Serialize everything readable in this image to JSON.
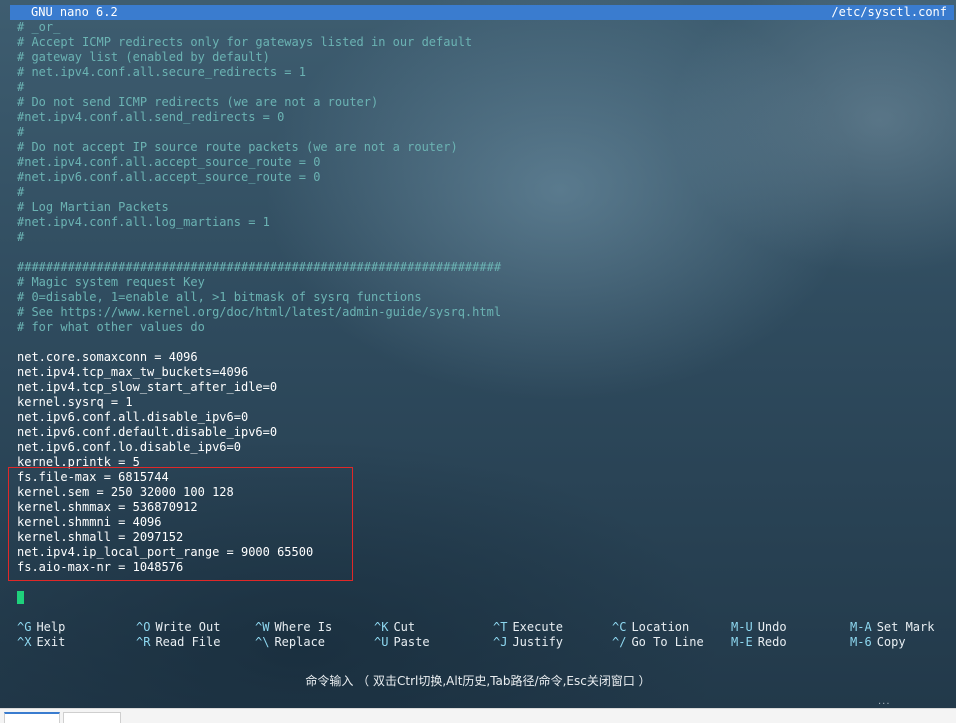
{
  "titlebar": {
    "app": "GNU nano 6.2",
    "file": "/etc/sysctl.conf"
  },
  "editor_lines": [
    {
      "type": "comment",
      "text": "# _or_"
    },
    {
      "type": "comment",
      "text": "# Accept ICMP redirects only for gateways listed in our default"
    },
    {
      "type": "comment",
      "text": "# gateway list (enabled by default)"
    },
    {
      "type": "comment",
      "text": "# net.ipv4.conf.all.secure_redirects = 1"
    },
    {
      "type": "comment",
      "text": "#"
    },
    {
      "type": "comment",
      "text": "# Do not send ICMP redirects (we are not a router)"
    },
    {
      "type": "comment",
      "text": "#net.ipv4.conf.all.send_redirects = 0"
    },
    {
      "type": "comment",
      "text": "#"
    },
    {
      "type": "comment",
      "text": "# Do not accept IP source route packets (we are not a router)"
    },
    {
      "type": "comment",
      "text": "#net.ipv4.conf.all.accept_source_route = 0"
    },
    {
      "type": "comment",
      "text": "#net.ipv6.conf.all.accept_source_route = 0"
    },
    {
      "type": "comment",
      "text": "#"
    },
    {
      "type": "comment",
      "text": "# Log Martian Packets"
    },
    {
      "type": "comment",
      "text": "#net.ipv4.conf.all.log_martians = 1"
    },
    {
      "type": "comment",
      "text": "#"
    },
    {
      "type": "blank",
      "text": ""
    },
    {
      "type": "comment",
      "text": "###################################################################"
    },
    {
      "type": "comment",
      "text": "# Magic system request Key"
    },
    {
      "type": "comment",
      "text": "# 0=disable, 1=enable all, >1 bitmask of sysrq functions"
    },
    {
      "type": "comment",
      "text": "# See https://www.kernel.org/doc/html/latest/admin-guide/sysrq.html"
    },
    {
      "type": "comment",
      "text": "# for what other values do"
    },
    {
      "type": "blank",
      "text": ""
    },
    {
      "type": "setting",
      "text": "net.core.somaxconn = 4096"
    },
    {
      "type": "setting",
      "text": "net.ipv4.tcp_max_tw_buckets=4096"
    },
    {
      "type": "setting",
      "text": "net.ipv4.tcp_slow_start_after_idle=0"
    },
    {
      "type": "setting",
      "text": "kernel.sysrq = 1"
    },
    {
      "type": "setting",
      "text": "net.ipv6.conf.all.disable_ipv6=0"
    },
    {
      "type": "setting",
      "text": "net.ipv6.conf.default.disable_ipv6=0"
    },
    {
      "type": "setting",
      "text": "net.ipv6.conf.lo.disable_ipv6=0"
    },
    {
      "type": "setting",
      "text": "kernel.printk = 5"
    },
    {
      "type": "setting",
      "text": "fs.file-max = 6815744"
    },
    {
      "type": "setting",
      "text": "kernel.sem = 250 32000 100 128"
    },
    {
      "type": "setting",
      "text": "kernel.shmmax = 536870912"
    },
    {
      "type": "setting",
      "text": "kernel.shmmni = 4096"
    },
    {
      "type": "setting",
      "text": "kernel.shmall = 2097152"
    },
    {
      "type": "setting",
      "text": "net.ipv4.ip_local_port_range = 9000 65500"
    },
    {
      "type": "setting",
      "text": "fs.aio-max-nr = 1048576"
    }
  ],
  "shortcuts": [
    {
      "key": "^G",
      "label": "Help"
    },
    {
      "key": "^O",
      "label": "Write Out"
    },
    {
      "key": "^W",
      "label": "Where Is"
    },
    {
      "key": "^K",
      "label": "Cut"
    },
    {
      "key": "^T",
      "label": "Execute"
    },
    {
      "key": "^C",
      "label": "Location"
    },
    {
      "key": "M-U",
      "label": "Undo"
    },
    {
      "key": "M-A",
      "label": "Set Mark"
    },
    {
      "key": "^X",
      "label": "Exit"
    },
    {
      "key": "^R",
      "label": "Read File"
    },
    {
      "key": "^\\",
      "label": "Replace"
    },
    {
      "key": "^U",
      "label": "Paste"
    },
    {
      "key": "^J",
      "label": "Justify"
    },
    {
      "key": "^/",
      "label": "Go To Line"
    },
    {
      "key": "M-E",
      "label": "Redo"
    },
    {
      "key": "M-6",
      "label": "Copy"
    }
  ],
  "command_bar": {
    "text": "命令输入 （ 双击Ctrl切换,Alt历史,Tab路径/命令,Esc关闭窗口 ）"
  },
  "colors": {
    "titlebar_bg": "#3a7ccf",
    "comment": "#6bb3b3",
    "setting": "#ffffff",
    "shortcut_key": "#8ed8f0",
    "cursor": "#1fd17c",
    "highlight_border": "#e02828"
  }
}
